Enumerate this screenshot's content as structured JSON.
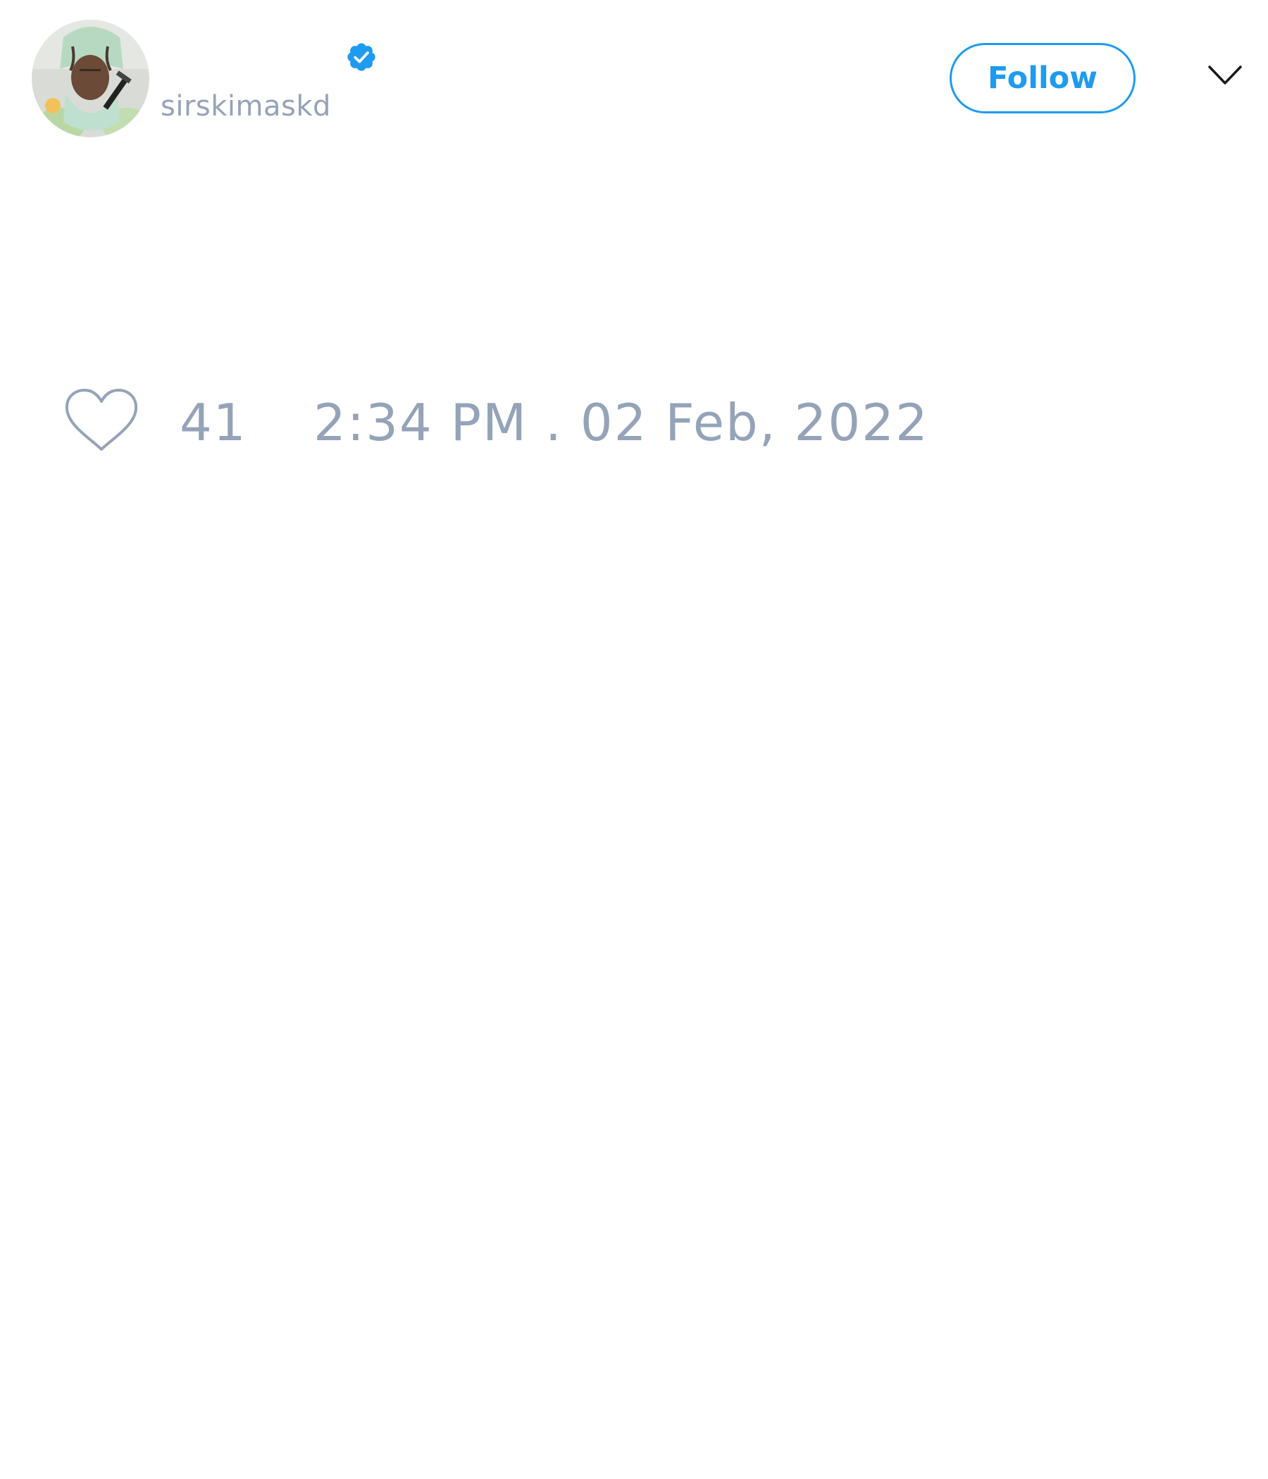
{
  "author": {
    "display_name": "",
    "handle": "sirskimaskd",
    "verified": true,
    "avatar_icon": "profile-photo"
  },
  "actions": {
    "follow_label": "Follow",
    "menu_icon": "chevron-down-icon"
  },
  "stats": {
    "like_icon": "heart-outline-icon",
    "like_count": "41",
    "timestamp": "2:34 PM . 02 Feb, 2022"
  },
  "colors": {
    "accent": "#1d9bf0",
    "muted_text": "#94a3b8",
    "background": "#ffffff"
  }
}
